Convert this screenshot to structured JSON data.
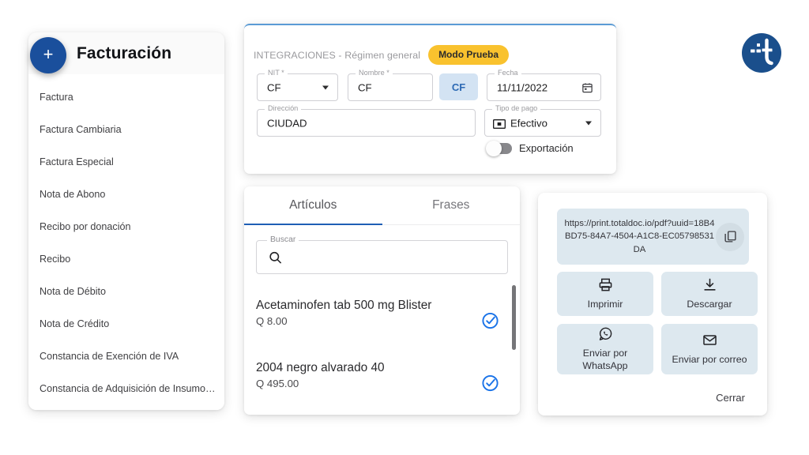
{
  "sidebar": {
    "title": "Facturación",
    "add_button_icon": "plus-icon",
    "items": [
      {
        "label": "Factura"
      },
      {
        "label": "Factura Cambiaria"
      },
      {
        "label": "Factura Especial"
      },
      {
        "label": "Nota de Abono"
      },
      {
        "label": "Recibo por donación"
      },
      {
        "label": "Recibo"
      },
      {
        "label": "Nota de Débito"
      },
      {
        "label": "Nota de Crédito"
      },
      {
        "label": "Constancia de Exención de IVA"
      },
      {
        "label": "Constancia de Adquisición de Insumo…"
      }
    ]
  },
  "form": {
    "integraciones_label": "INTEGRACIONES - Régimen general",
    "mode_badge": "Modo Prueba",
    "fields": {
      "nit": {
        "label": "NIT *",
        "value": "CF"
      },
      "nombre": {
        "label": "Nombre *",
        "value": "CF"
      },
      "fecha": {
        "label": "Fecha",
        "value": "11/11/2022"
      },
      "direccion": {
        "label": "Dirección",
        "value": "CIUDAD"
      },
      "tipo_pago": {
        "label": "Tipo de pago",
        "value": "Efectivo"
      }
    },
    "cf_button": "CF",
    "export_label": "Exportación",
    "export_enabled": false
  },
  "articles_panel": {
    "tabs": [
      {
        "label": "Artículos",
        "active": true
      },
      {
        "label": "Frases",
        "active": false
      }
    ],
    "search": {
      "label": "Buscar",
      "value": "",
      "placeholder": ""
    },
    "items": [
      {
        "name": "Acetaminofen tab 500 mg Blister",
        "price": "Q 8.00",
        "selected": true
      },
      {
        "name": "2004 negro alvarado 40",
        "price": "Q 495.00",
        "selected": true
      }
    ]
  },
  "actions_panel": {
    "url": "https://print.totaldoc.io/pdf?uuid=18B4BD75-84A7-4504-A1C8-EC05798531DA",
    "copy_icon": "copy-icon",
    "buttons": [
      {
        "label": "Imprimir",
        "icon": "printer-icon"
      },
      {
        "label": "Descargar",
        "icon": "download-icon"
      },
      {
        "label": "Enviar por WhatsApp",
        "icon": "whatsapp-icon"
      },
      {
        "label": "Enviar por correo",
        "icon": "mail-icon"
      }
    ],
    "close_label": "Cerrar"
  },
  "colors": {
    "brand_blue": "#1a4f9c",
    "accent_yellow": "#f9c22e",
    "tab_underline": "#1f5fb5",
    "check_blue": "#1a73e8",
    "panel_blue_gray": "#dde8ef"
  }
}
